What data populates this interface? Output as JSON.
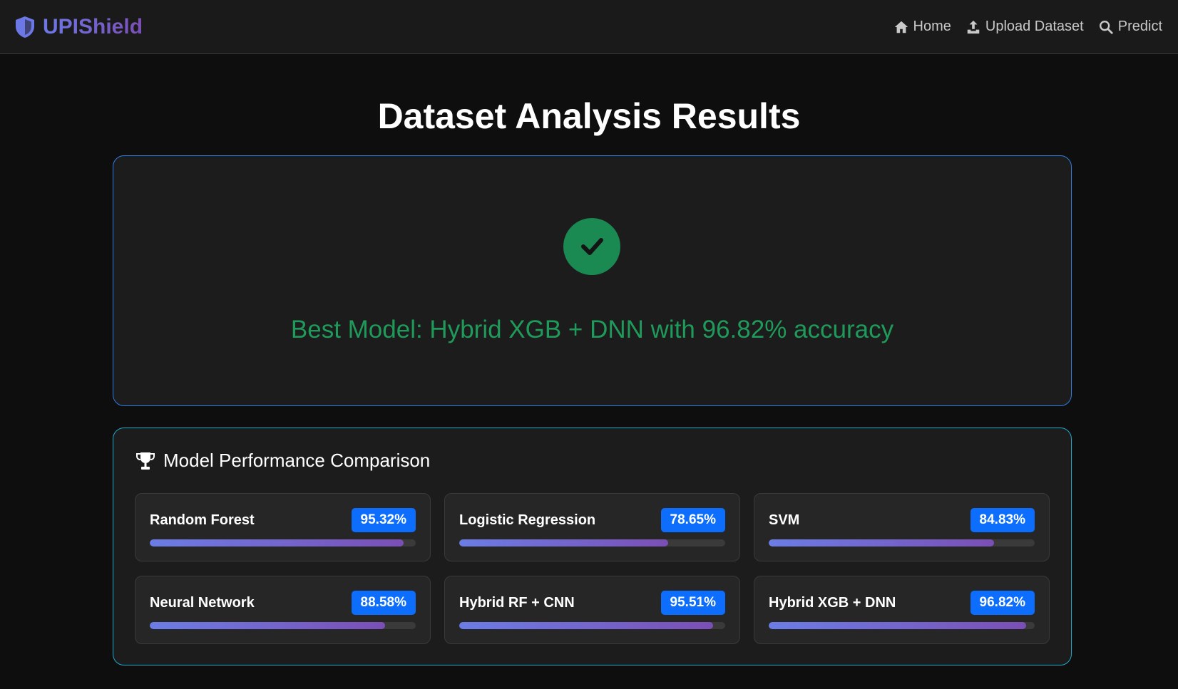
{
  "brand": {
    "name": "UPIShield",
    "icon": "shield-icon",
    "color": "#6c78e6"
  },
  "nav": [
    {
      "label": "Home",
      "icon": "home-icon"
    },
    {
      "label": "Upload Dataset",
      "icon": "upload-icon"
    },
    {
      "label": "Predict",
      "icon": "search-icon"
    }
  ],
  "page": {
    "title": "Dataset Analysis Results"
  },
  "best_model": {
    "icon": "check-circle-icon",
    "text": "Best Model: Hybrid XGB + DNN with 96.82% accuracy",
    "color": "#1f9a5a"
  },
  "performance": {
    "title": "Model Performance Comparison",
    "icon": "trophy-icon",
    "models": [
      {
        "name": "Random Forest",
        "accuracy_label": "95.32%",
        "accuracy": 95.32
      },
      {
        "name": "Logistic Regression",
        "accuracy_label": "78.65%",
        "accuracy": 78.65
      },
      {
        "name": "SVM",
        "accuracy_label": "84.83%",
        "accuracy": 84.83
      },
      {
        "name": "Neural Network",
        "accuracy_label": "88.58%",
        "accuracy": 88.58
      },
      {
        "name": "Hybrid RF + CNN",
        "accuracy_label": "95.51%",
        "accuracy": 95.51
      },
      {
        "name": "Hybrid XGB + DNN",
        "accuracy_label": "96.82%",
        "accuracy": 96.82
      }
    ],
    "badge_color": "#0d6efd"
  }
}
